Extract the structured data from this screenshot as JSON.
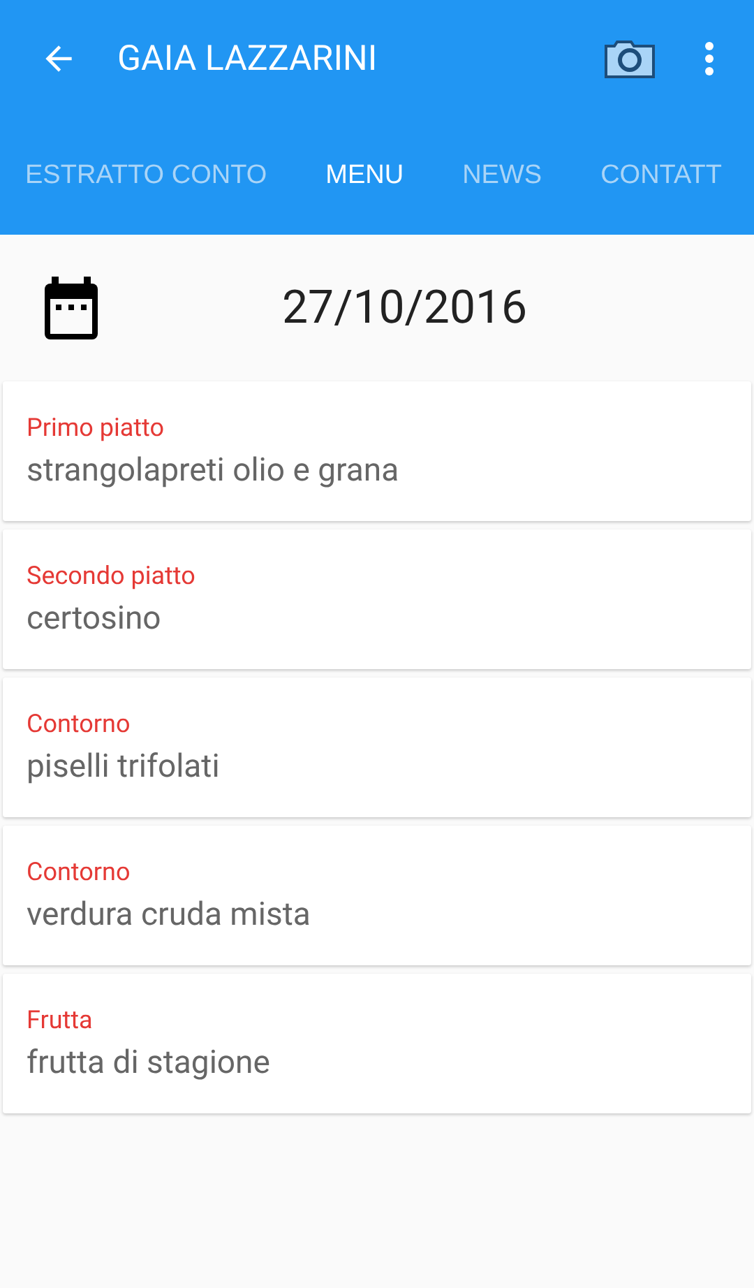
{
  "app_bar": {
    "title": "GAIA LAZZARINI"
  },
  "tabs": [
    {
      "label": "ESTRATTO CONTO",
      "selected": false
    },
    {
      "label": "MENU",
      "selected": true
    },
    {
      "label": "NEWS",
      "selected": false
    },
    {
      "label": "CONTATT",
      "selected": false
    }
  ],
  "date": "27/10/2016",
  "courses": [
    {
      "category": "Primo piatto",
      "dish": "strangolapreti olio e grana"
    },
    {
      "category": "Secondo piatto",
      "dish": "certosino"
    },
    {
      "category": "Contorno",
      "dish": "piselli trifolati"
    },
    {
      "category": "Contorno",
      "dish": "verdura cruda mista"
    },
    {
      "category": "Frutta",
      "dish": "frutta di stagione"
    }
  ]
}
